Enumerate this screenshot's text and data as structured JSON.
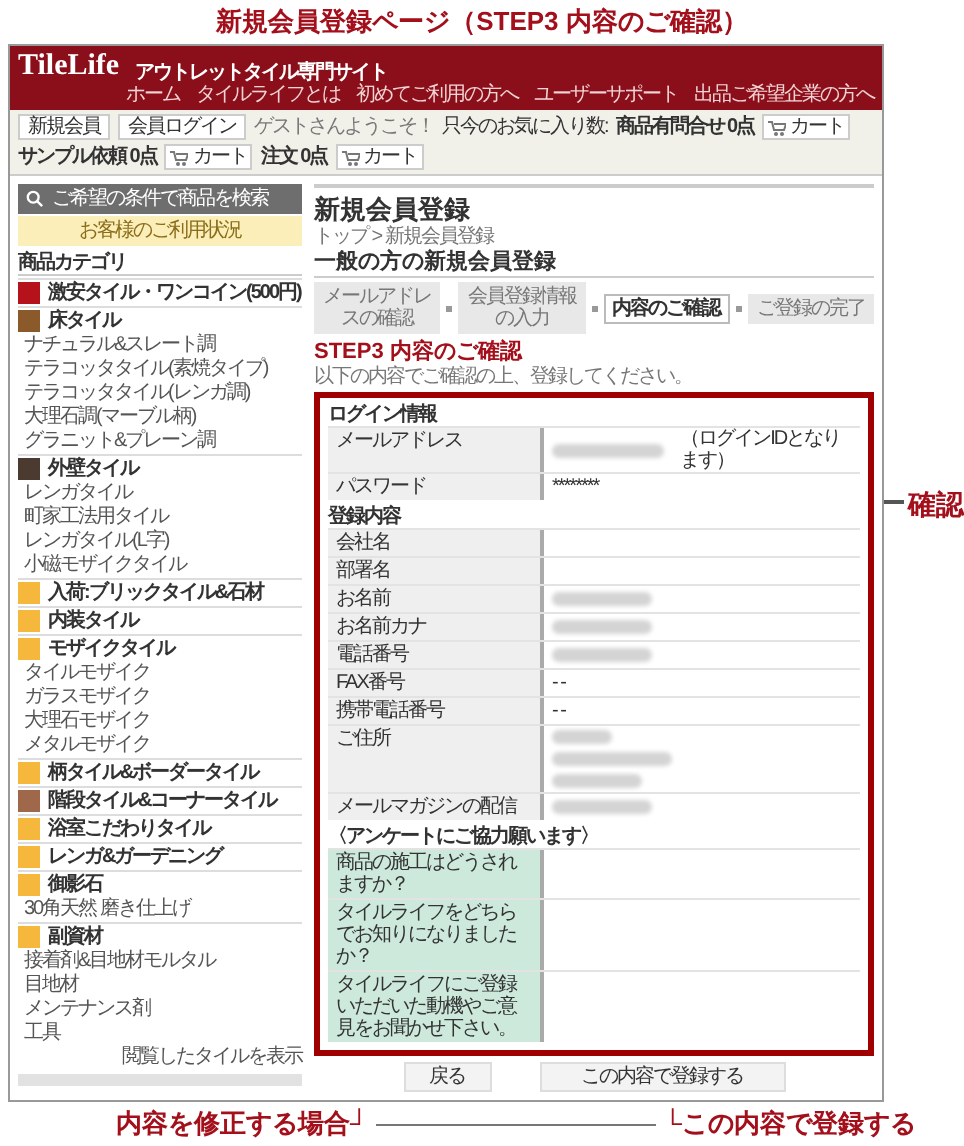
{
  "page_title": "新規会員登録ページ（STEP3 内容のご確認）",
  "header": {
    "logo": "TileLife",
    "tagline": "アウトレットタイル専門サイト",
    "links": [
      "ホーム",
      "タイルライフとは",
      "初めてご利用の方へ",
      "ユーザーサポート",
      "出品ご希望企業の方へ"
    ]
  },
  "toolbar": {
    "buttons": [
      "新規会員",
      "会員ログイン"
    ],
    "greeting": "ゲストさんようこそ！",
    "favorites_label": "只今のお気に入り数:",
    "counters": [
      {
        "label": "商品有問合せ 0点",
        "cart": "カート"
      },
      {
        "label": "サンプル依頼 0点",
        "cart": "カート"
      },
      {
        "label": "注文 0点",
        "cart": "カート"
      }
    ]
  },
  "sidebar": {
    "items": [
      {
        "kind": "search",
        "label": "ご希望の条件で商品を検索"
      },
      {
        "kind": "status",
        "label": "お客様のご利用状況"
      },
      {
        "kind": "heading",
        "label": "商品カテゴリ"
      },
      {
        "kind": "category",
        "label": "激安タイル・ワンコイン(500円)",
        "color": "#b5121b"
      },
      {
        "kind": "category",
        "label": "床タイル",
        "color": "#8b5a2b"
      },
      {
        "kind": "sub",
        "label": "ナチュラル&スレート調"
      },
      {
        "kind": "sub",
        "label": "テラコッタタイル(素焼タイプ)"
      },
      {
        "kind": "sub",
        "label": "テラコッタタイル(レンガ調)"
      },
      {
        "kind": "sub",
        "label": "大理石調(マーブル柄)"
      },
      {
        "kind": "sub",
        "label": "グラニット&プレーン調"
      },
      {
        "kind": "category",
        "label": "外壁タイル",
        "color": "#4a3a30"
      },
      {
        "kind": "sub",
        "label": "レンガタイル"
      },
      {
        "kind": "sub",
        "label": "町家工法用タイル"
      },
      {
        "kind": "sub",
        "label": "レンガタイル(L字)"
      },
      {
        "kind": "sub",
        "label": "小磁モザイクタイル"
      },
      {
        "kind": "category",
        "label": "入荷:ブリックタイル&石材",
        "color": "#f5b83d"
      },
      {
        "kind": "category",
        "label": "内装タイル",
        "color": "#f5b83d"
      },
      {
        "kind": "category",
        "label": "モザイクタイル",
        "color": "#f5b83d"
      },
      {
        "kind": "sub",
        "label": "タイルモザイク"
      },
      {
        "kind": "sub",
        "label": "ガラスモザイク"
      },
      {
        "kind": "sub",
        "label": "大理石モザイク"
      },
      {
        "kind": "sub",
        "label": "メタルモザイク"
      },
      {
        "kind": "category",
        "label": "柄タイル&ボーダータイル",
        "color": "#f5b83d"
      },
      {
        "kind": "category",
        "label": "階段タイル&コーナータイル",
        "color": "#a0684a"
      },
      {
        "kind": "category",
        "label": "浴室こだわりタイル",
        "color": "#f5b83d"
      },
      {
        "kind": "category",
        "label": "レンガ&ガーデニング",
        "color": "#f5b83d"
      },
      {
        "kind": "category",
        "label": "御影石",
        "color": "#f5b83d"
      },
      {
        "kind": "sub",
        "label": "30角天然 磨き仕上げ"
      },
      {
        "kind": "category",
        "label": "副資材",
        "color": "#f5b83d"
      },
      {
        "kind": "sub",
        "label": "接着剤&目地材モルタル"
      },
      {
        "kind": "sub",
        "label": "目地材"
      },
      {
        "kind": "sub",
        "label": "メンテナンス剤"
      },
      {
        "kind": "sub",
        "label": "工具"
      },
      {
        "kind": "more",
        "label": "閲覧したタイルを表示"
      },
      {
        "kind": "footer"
      }
    ]
  },
  "main": {
    "heading": "新規会員登録",
    "breadcrumb": "トップ > 新規会員登録",
    "subtitle": "一般の方の新規会員登録",
    "steps": [
      {
        "label": "メールアドレスの確認",
        "selected": false
      },
      {
        "label": "会員登録情報の入力",
        "selected": false
      },
      {
        "label": "内容のご確認",
        "selected": true
      },
      {
        "label": "ご登録の完了",
        "selected": false
      }
    ],
    "step_title": "STEP3 内容のご確認",
    "step_note": "以下の内容でご確認の上、登録してください。",
    "sections": [
      {
        "title": "ログイン情報",
        "kind": "info",
        "rows": [
          {
            "label": "メールアドレス",
            "kind": "blurred_note",
            "value": "（ログインIDとなります）"
          },
          {
            "label": "パスワード",
            "kind": "text",
            "value": "********"
          }
        ]
      },
      {
        "title": "登録内容",
        "kind": "info",
        "rows": [
          {
            "label": "会社名",
            "kind": "blank"
          },
          {
            "label": "部署名",
            "kind": "blank"
          },
          {
            "label": "お名前",
            "kind": "blurred"
          },
          {
            "label": "お名前カナ",
            "kind": "blurred"
          },
          {
            "label": "電話番号",
            "kind": "blurred"
          },
          {
            "label": "FAX番号",
            "kind": "text",
            "value": "- -"
          },
          {
            "label": "携帯電話番号",
            "kind": "text",
            "value": "- -"
          },
          {
            "label": "ご住所",
            "kind": "blurred_address"
          },
          {
            "label": "メールマガジンの配信",
            "kind": "blurred"
          }
        ]
      },
      {
        "title": "〈アンケートにご協力願います〉",
        "kind": "survey",
        "rows": [
          {
            "label": "商品の施工はどうされますか？",
            "kind": "blank"
          },
          {
            "label": "タイルライフをどちらでお知りになりましたか？",
            "kind": "blank"
          },
          {
            "label": "タイルライフにご登録いただいた動機やご意見をお聞かせ下さい。",
            "kind": "blank"
          }
        ]
      }
    ],
    "buttons": [
      "戻る",
      "この内容で登録する"
    ]
  },
  "annotations": {
    "confirm": "確認",
    "back": "内容を修正する場合┘",
    "submit": "└この内容で登録する"
  }
}
